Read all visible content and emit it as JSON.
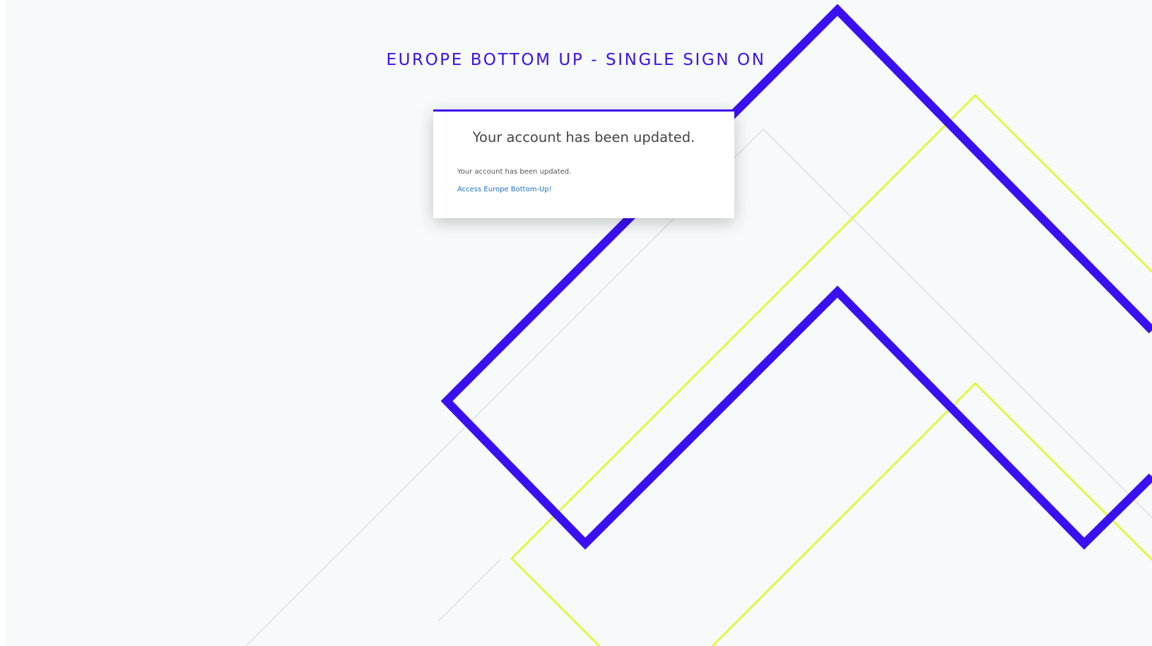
{
  "page": {
    "title": "EUROPE BOTTOM UP - SINGLE SIGN ON"
  },
  "card": {
    "heading": "Your account has been updated.",
    "message": "Your account has been updated.",
    "link_label": "Access Europe Bottom-Up!"
  },
  "theme": {
    "accent": "#3b10f0",
    "highlight": "#e3f741",
    "background": "#f6fafb",
    "link": "#1a73c6"
  },
  "decorations": {
    "bg_pattern": "geometric-diamond-lines"
  }
}
